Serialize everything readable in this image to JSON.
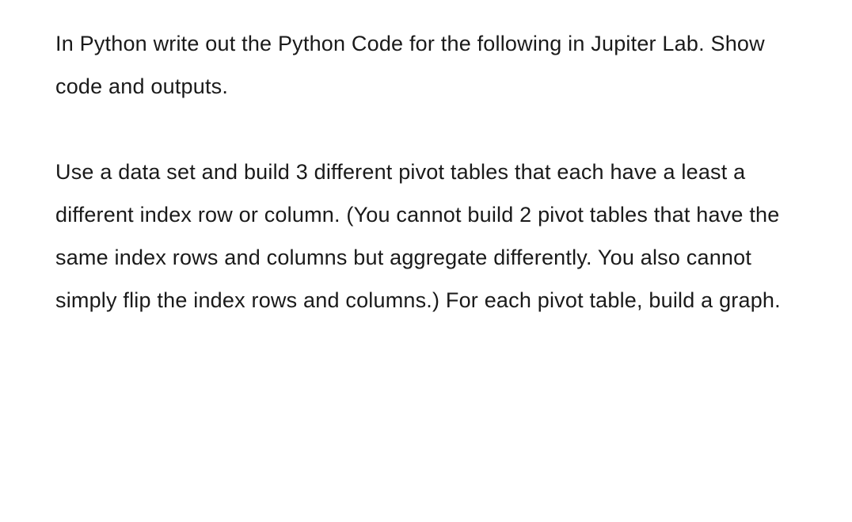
{
  "paragraphs": {
    "p1": "In Python write out the Python Code for the following in Jupiter Lab. Show code and outputs.",
    "p2": "Use a data set and build 3 different pivot tables that each have a least a different index row or column. (You cannot build 2 pivot tables that have the same index rows and columns but aggregate differently. You also cannot simply flip the index rows and columns.) For each pivot table, build a graph."
  }
}
